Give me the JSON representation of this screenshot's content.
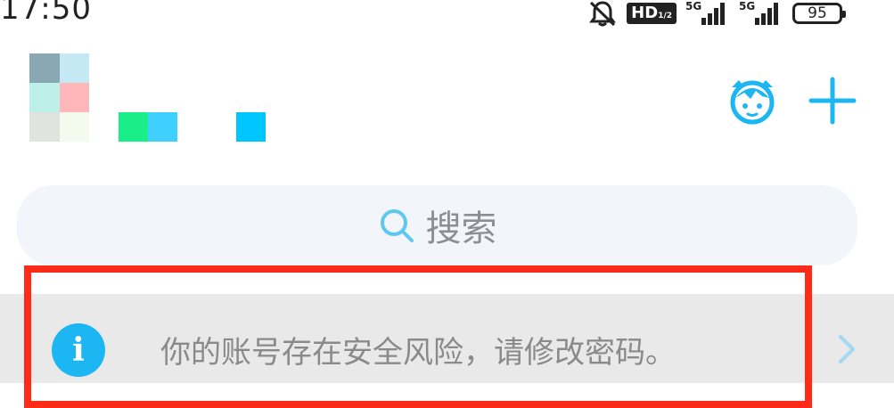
{
  "status_bar": {
    "time": "17:50",
    "hd_label": "HD",
    "hd_sub": "1/2",
    "signal_1": "5G",
    "signal_2": "5G",
    "battery": "95",
    "icons": [
      "bell-muted-icon",
      "hd-voice-icon",
      "signal-5g-icon",
      "signal-5g-icon",
      "battery-icon"
    ]
  },
  "header": {
    "avatar_colors": [
      "#8aa8b3",
      "#c4e8f4",
      "#bdf0e8",
      "#ffb7b9",
      "#dfe4e0",
      "#f3faee"
    ],
    "nickname_colors": [
      "#19ee88",
      "#3fd0ff",
      "#ffffff",
      "#ffffff",
      "#00c6ff"
    ],
    "icons": [
      "robot-assistant-icon",
      "plus-icon"
    ]
  },
  "search": {
    "placeholder": "搜索",
    "icon": "search-icon"
  },
  "notice": {
    "text": "你的账号存在安全风险，请修改密码。",
    "icon": "info-icon",
    "info_glyph": "i",
    "chevron": "chevron-right-icon"
  },
  "colors": {
    "accent": "#1cb6f2",
    "highlight": "#ff2a17"
  }
}
